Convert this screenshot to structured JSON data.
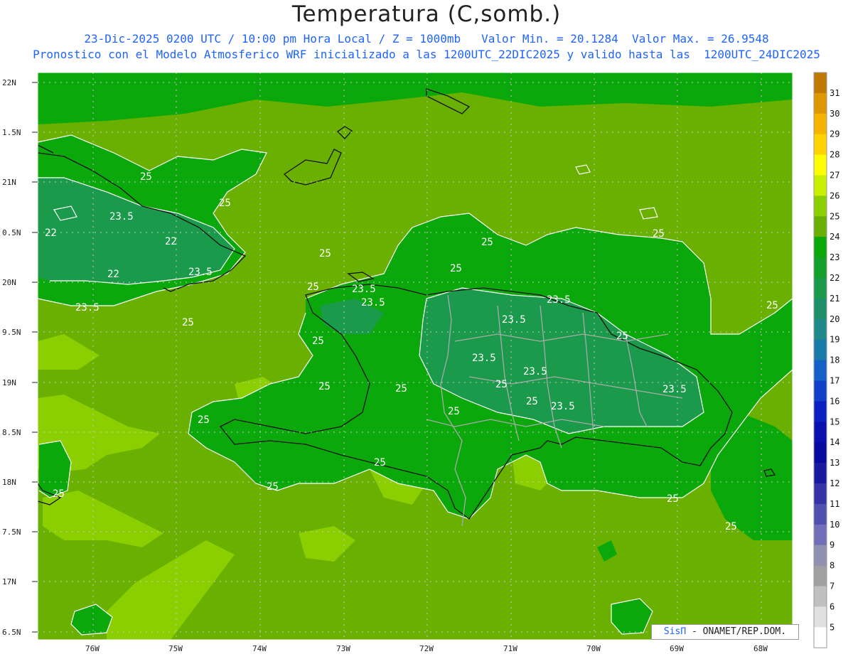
{
  "header": {
    "title": "Temperatura (C,somb.)",
    "subtitle_line1": "23-Dic-2025 0200 UTC / 10:00 pm Hora Local / Z = 1000mb   Valor Min. = 20.1284  Valor Max. = 26.9548",
    "subtitle_line2": "Pronostico con el Modelo Atmosferico WRF inicializado a las 1200UTC_22DIC2025 y valido hasta las  1200UTC_24DIC2025"
  },
  "map": {
    "lat_labels": [
      "22N",
      "1.5N",
      "21N",
      "0.5N",
      "20N",
      "9.5N",
      "19N",
      "8.5N",
      "18N",
      "7.5N",
      "17N",
      "6.5N"
    ],
    "lon_labels": [
      "76W",
      "75W",
      "74W",
      "73W",
      "72W",
      "71W",
      "70W",
      "69W",
      "68W"
    ],
    "contour_labels": [
      {
        "text": "25"
      },
      {
        "text": "25"
      },
      {
        "text": "23.5"
      },
      {
        "text": "22"
      },
      {
        "text": "22"
      },
      {
        "text": "22"
      },
      {
        "text": "23.5"
      },
      {
        "text": "23.5"
      },
      {
        "text": "25"
      },
      {
        "text": "25"
      },
      {
        "text": "25"
      },
      {
        "text": "25"
      },
      {
        "text": "23.5"
      },
      {
        "text": "23.5"
      },
      {
        "text": "25"
      },
      {
        "text": "23.5"
      },
      {
        "text": "25"
      },
      {
        "text": "23.5"
      },
      {
        "text": "23.5"
      },
      {
        "text": "25"
      },
      {
        "text": "25"
      },
      {
        "text": "25"
      },
      {
        "text": "25"
      },
      {
        "text": "23.5"
      },
      {
        "text": "25"
      },
      {
        "text": "25"
      },
      {
        "text": "23.5"
      },
      {
        "text": "23.5"
      },
      {
        "text": "25"
      },
      {
        "text": "25"
      },
      {
        "text": "25"
      },
      {
        "text": "25"
      },
      {
        "text": "25"
      },
      {
        "text": "25"
      },
      {
        "text": "25"
      },
      {
        "text": "25"
      }
    ],
    "colors": {
      "background_green": "#6ab000",
      "land_green": "#0aa80a",
      "cool_teal": "#1a9a4a",
      "warm_lightgreen": "#8ccf00",
      "coastline": "#111111",
      "border": "#aaaaaa"
    }
  },
  "colorbar": {
    "levels": [
      "31",
      "30",
      "29",
      "28",
      "27",
      "26",
      "25",
      "24",
      "23",
      "22",
      "21",
      "20",
      "19",
      "18",
      "17",
      "16",
      "15",
      "14",
      "13",
      "12",
      "11",
      "10",
      "9",
      "8",
      "7",
      "6",
      "5"
    ],
    "colors": [
      "#c07800",
      "#e09600",
      "#f5b400",
      "#ffd200",
      "#ffff00",
      "#c8f000",
      "#8ccf00",
      "#6ab000",
      "#0aa80a",
      "#14a02a",
      "#1a9a4a",
      "#1e9068",
      "#1e8a8a",
      "#1a7aa8",
      "#1560c8",
      "#1040c8",
      "#0a20c0",
      "#0a10b0",
      "#0a0aa0",
      "#1a1aa0",
      "#3434a8",
      "#5050b0",
      "#7070b8",
      "#9090b0",
      "#a0a0a0",
      "#c0c0c0",
      "#e0e0e0",
      "#ffffff"
    ]
  },
  "credit": {
    "brand": "SisΠ",
    "text": " - ONAMET/REP.DOM."
  }
}
